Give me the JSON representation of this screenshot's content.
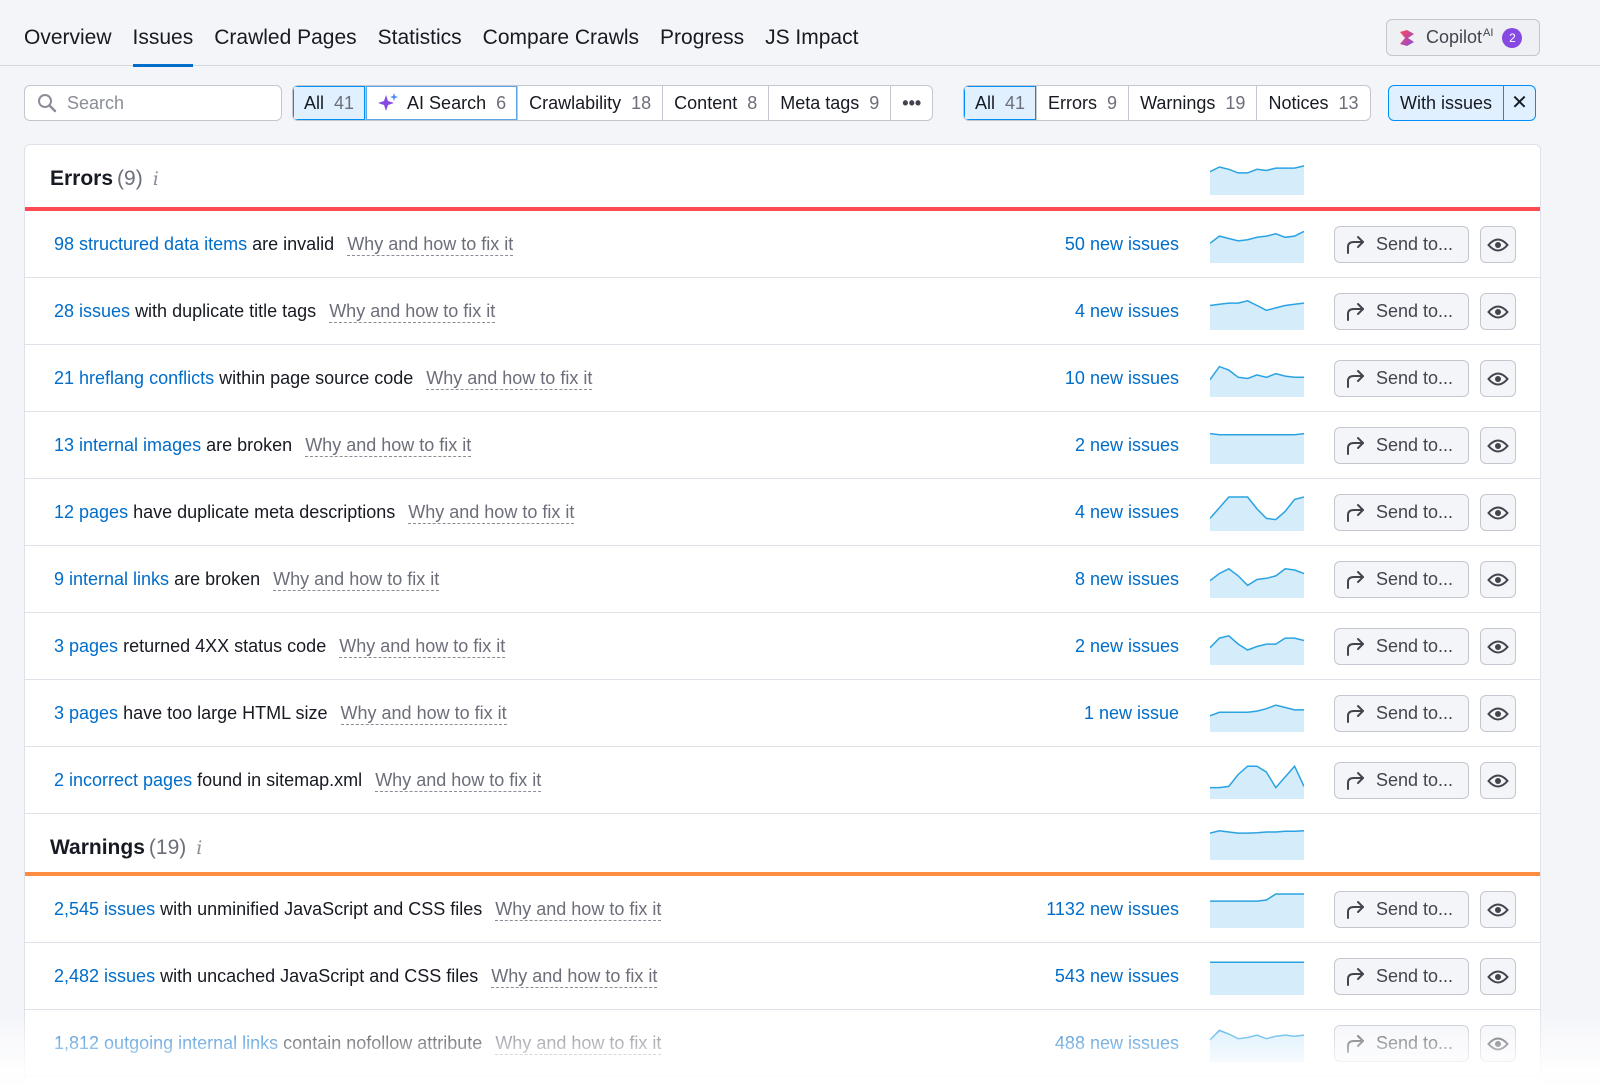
{
  "nav": {
    "tabs": [
      {
        "label": "Overview"
      },
      {
        "label": "Issues",
        "active": true
      },
      {
        "label": "Crawled Pages"
      },
      {
        "label": "Statistics"
      },
      {
        "label": "Compare Crawls"
      },
      {
        "label": "Progress"
      },
      {
        "label": "JS Impact"
      }
    ],
    "copilot": {
      "label": "Copilot",
      "ai_sup": "AI",
      "badge": "2"
    }
  },
  "search": {
    "placeholder": "Search",
    "value": ""
  },
  "category_filter": {
    "items": [
      {
        "label": "All",
        "count": "41",
        "selected": true
      },
      {
        "label": "AI Search",
        "count": "6",
        "icon": "sparkle-icon"
      },
      {
        "label": "Crawlability",
        "count": "18"
      },
      {
        "label": "Content",
        "count": "8"
      },
      {
        "label": "Meta tags",
        "count": "9"
      }
    ],
    "more": "•••"
  },
  "type_filter": {
    "items": [
      {
        "label": "All",
        "count": "41",
        "selected": true
      },
      {
        "label": "Errors",
        "count": "9"
      },
      {
        "label": "Warnings",
        "count": "19"
      },
      {
        "label": "Notices",
        "count": "13"
      }
    ]
  },
  "with_issues": {
    "label": "With issues",
    "clear": "✕"
  },
  "colors": {
    "accent": "#006dca",
    "error": "#ff4953",
    "warning": "#ff8c43",
    "trend": "#2aa3e2",
    "trend_fill": "#d5ecfb"
  },
  "sections": [
    {
      "title": "Errors",
      "count": "(9)",
      "trend": [
        0.45,
        0.25,
        0.35,
        0.5,
        0.5,
        0.35,
        0.4,
        0.3,
        0.3,
        0.3,
        0.2
      ],
      "rows": [
        {
          "link": "98 structured data items",
          "text": "are invalid",
          "why": "Why and how to fix it",
          "new": "50 new issues",
          "trend": [
            0.6,
            0.3,
            0.4,
            0.5,
            0.45,
            0.35,
            0.3,
            0.2,
            0.35,
            0.3,
            0.1
          ]
        },
        {
          "link": "28 issues",
          "text": "with duplicate title tags",
          "why": "Why and how to fix it",
          "new": "4 new issues",
          "trend": [
            0.4,
            0.35,
            0.3,
            0.3,
            0.2,
            0.4,
            0.6,
            0.5,
            0.4,
            0.35,
            0.3
          ]
        },
        {
          "link": "21 hreflang conflicts",
          "text": "within page source code",
          "why": "Why and how to fix it",
          "new": "10 new issues",
          "trend": [
            0.7,
            0.15,
            0.3,
            0.6,
            0.65,
            0.5,
            0.6,
            0.45,
            0.55,
            0.6,
            0.6
          ]
        },
        {
          "link": "13 internal images",
          "text": "are broken",
          "why": "Why and how to fix it",
          "new": "2 new issues",
          "trend": [
            0.15,
            0.2,
            0.2,
            0.2,
            0.2,
            0.2,
            0.2,
            0.2,
            0.2,
            0.2,
            0.15
          ]
        },
        {
          "link": "12 pages",
          "text": "have duplicate meta descriptions",
          "why": "Why and how to fix it",
          "new": "4 new issues",
          "trend": [
            0.9,
            0.45,
            0.0,
            0.0,
            0.0,
            0.5,
            0.9,
            0.95,
            0.6,
            0.1,
            0.0
          ]
        },
        {
          "link": "9 internal links",
          "text": "are broken",
          "why": "Why and how to fix it",
          "new": "8 new issues",
          "trend": [
            0.7,
            0.4,
            0.2,
            0.5,
            0.9,
            0.65,
            0.6,
            0.5,
            0.2,
            0.25,
            0.4
          ]
        },
        {
          "link": "3 pages",
          "text": "returned 4XX status code",
          "why": "Why and how to fix it",
          "new": "2 new issues",
          "trend": [
            0.7,
            0.3,
            0.2,
            0.55,
            0.8,
            0.65,
            0.55,
            0.55,
            0.3,
            0.3,
            0.4
          ]
        },
        {
          "link": "3 pages",
          "text": "have too large HTML size",
          "why": "Why and how to fix it",
          "new": "1 new issue",
          "trend": [
            0.75,
            0.6,
            0.6,
            0.6,
            0.6,
            0.55,
            0.45,
            0.3,
            0.4,
            0.5,
            0.5
          ]
        },
        {
          "link": "2 incorrect pages",
          "text": "found in sitemap.xml",
          "why": "Why and how to fix it",
          "new": "",
          "trend": [
            0.95,
            0.95,
            0.9,
            0.4,
            0.05,
            0.05,
            0.3,
            0.95,
            0.5,
            0.05,
            0.9
          ]
        }
      ]
    },
    {
      "title": "Warnings",
      "count": "(19)",
      "trend": [
        0.3,
        0.2,
        0.25,
        0.3,
        0.3,
        0.28,
        0.25,
        0.25,
        0.22,
        0.22,
        0.2
      ],
      "rows": [
        {
          "link": "2,545 issues",
          "text": "with unminified JavaScript and CSS files",
          "why": "Why and how to fix it",
          "new": "1132 new issues",
          "trend": [
            0.3,
            0.3,
            0.3,
            0.3,
            0.3,
            0.3,
            0.25,
            0.0,
            0.0,
            0.0,
            0.0
          ]
        },
        {
          "link": "2,482 issues",
          "text": "with uncached JavaScript and CSS files",
          "why": "Why and how to fix it",
          "new": "543 new issues",
          "trend": [
            0.05,
            0.05,
            0.05,
            0.05,
            0.05,
            0.05,
            0.05,
            0.05,
            0.05,
            0.05,
            0.05
          ]
        },
        {
          "link": "1,812 outgoing internal links",
          "text": "contain nofollow attribute",
          "why": "Why and how to fix it",
          "new": "488 new issues",
          "trend": [
            0.5,
            0.1,
            0.25,
            0.45,
            0.4,
            0.3,
            0.45,
            0.35,
            0.3,
            0.35,
            0.3
          ]
        }
      ]
    }
  ],
  "row_actions": {
    "send_label": "Send to...",
    "send_icon": "share-arrow-icon",
    "view_icon": "eye-icon"
  }
}
